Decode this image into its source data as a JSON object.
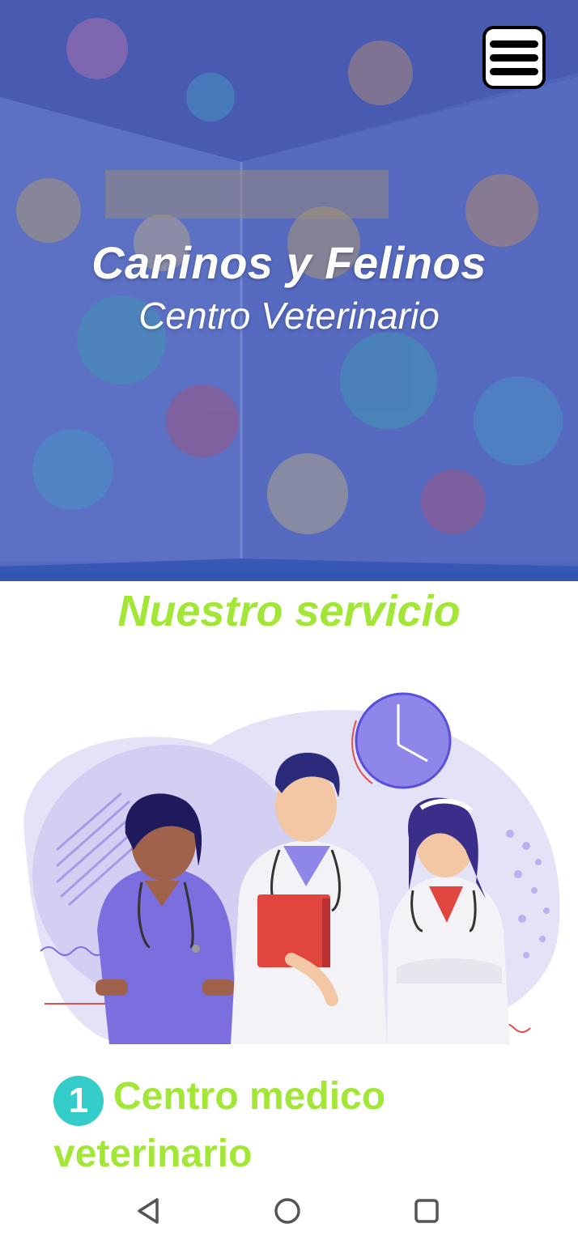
{
  "hero": {
    "title": "Caninos y Felinos",
    "subtitle": "Centro Veterinario",
    "menu_icon": "hamburger-menu-icon"
  },
  "services": {
    "heading": "Nuestro servicio",
    "illustration": "veterinary-staff-illustration",
    "items": [
      {
        "number": "1",
        "label": "Centro medico veterinario"
      }
    ]
  },
  "navigation": {
    "back_icon": "back-triangle-icon",
    "home_icon": "home-circle-icon",
    "recent_icon": "recent-apps-square-icon"
  },
  "colors": {
    "accent_green": "#a2e636",
    "number_teal": "#33ccc8",
    "hero_blue": "#4b63b6",
    "illustration_purple": "#7b6fe0"
  }
}
